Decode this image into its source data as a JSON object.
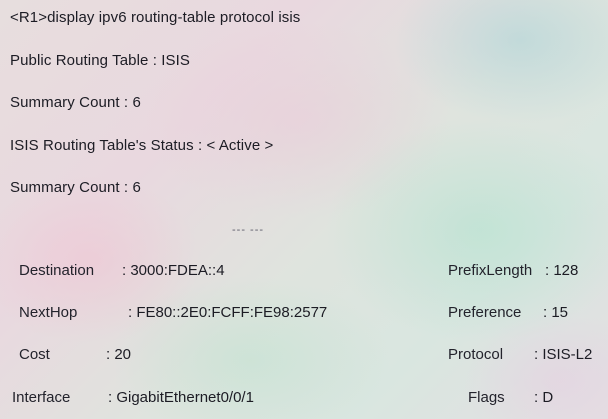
{
  "terminal": {
    "command_line": "<R1>display ipv6 routing-table protocol isis",
    "public_table": "Public Routing Table : ISIS",
    "summary_count_1": "Summary Count : 6",
    "table_status": "ISIS Routing Table's Status : < Active >",
    "summary_count_2": "Summary Count : 6",
    "separator": "--- ---"
  },
  "route": {
    "destination_label": "Destination",
    "destination_value": ": 3000:FDEA::4",
    "nexthop_label": "NextHop",
    "nexthop_value": ": FE80::2E0:FCFF:FE98:2577",
    "cost_label": "Cost",
    "cost_value": ": 20",
    "interface_label": "Interface",
    "interface_value": ": GigabitEthernet0/0/1",
    "prefixlength_label": "PrefixLength",
    "prefixlength_value": ": 128",
    "preference_label": "Preference",
    "preference_value": ": 15",
    "protocol_label": "Protocol",
    "protocol_value": ": ISIS-L2",
    "flags_label": "Flags",
    "flags_value": ": D"
  }
}
